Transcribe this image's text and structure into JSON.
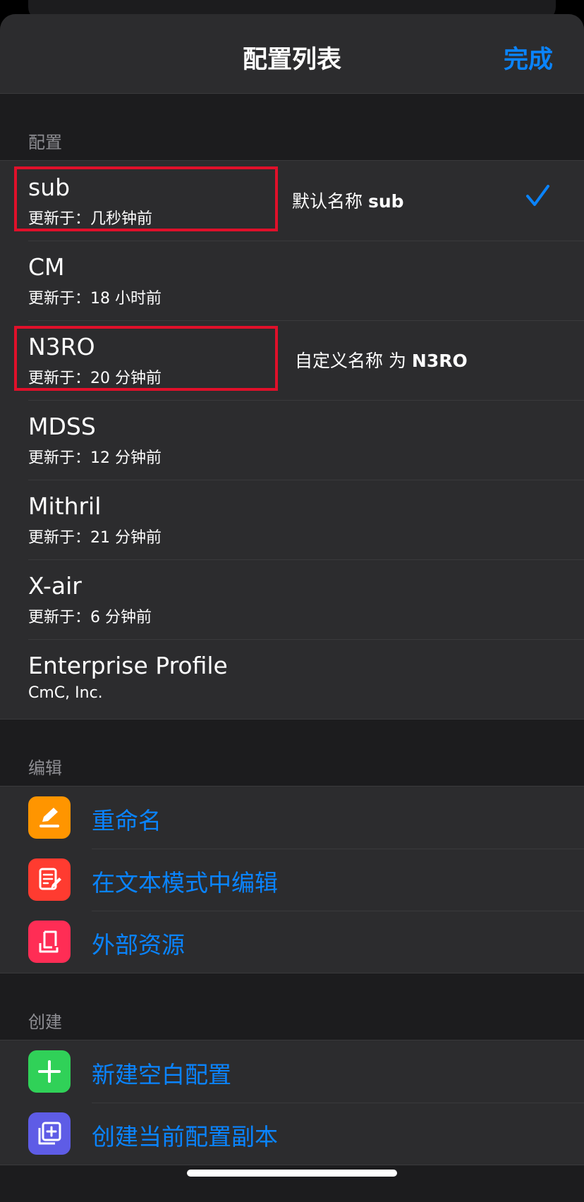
{
  "nav": {
    "title": "配置列表",
    "done": "完成"
  },
  "sections": {
    "profiles": "配置",
    "edit": "编辑",
    "create": "创建"
  },
  "profiles": [
    {
      "name": "sub",
      "updated": "更新于：几秒钟前"
    },
    {
      "name": "CM",
      "updated": "更新于：18 小时前"
    },
    {
      "name": "N3RO",
      "updated": "更新于：20 分钟前"
    },
    {
      "name": "MDSS",
      "updated": "更新于：12 分钟前"
    },
    {
      "name": "Mithril",
      "updated": "更新于：21 分钟前"
    },
    {
      "name": "X-air",
      "updated": "更新于：6 分钟前"
    },
    {
      "name": "Enterprise Profile",
      "updated": "CmC, Inc."
    }
  ],
  "notes": {
    "default_prefix": "默认名称 ",
    "default_name": "sub",
    "custom_prefix": "自定义名称 为 ",
    "custom_name": "N3RO"
  },
  "edit_actions": [
    {
      "label": "重命名",
      "icon": "pencil-icon",
      "color": "#ff9500"
    },
    {
      "label": "在文本模式中编辑",
      "icon": "text-edit-icon",
      "color": "#ff3b30"
    },
    {
      "label": "外部资源",
      "icon": "document-icon",
      "color": "#ff2d55"
    }
  ],
  "create_actions": [
    {
      "label": "新建空白配置",
      "icon": "plus-icon",
      "color": "#30d158"
    },
    {
      "label": "创建当前配置副本",
      "icon": "duplicate-icon",
      "color": "#5e5ce6"
    }
  ],
  "accent": "#0a84ff",
  "highlight": "#e0102a"
}
